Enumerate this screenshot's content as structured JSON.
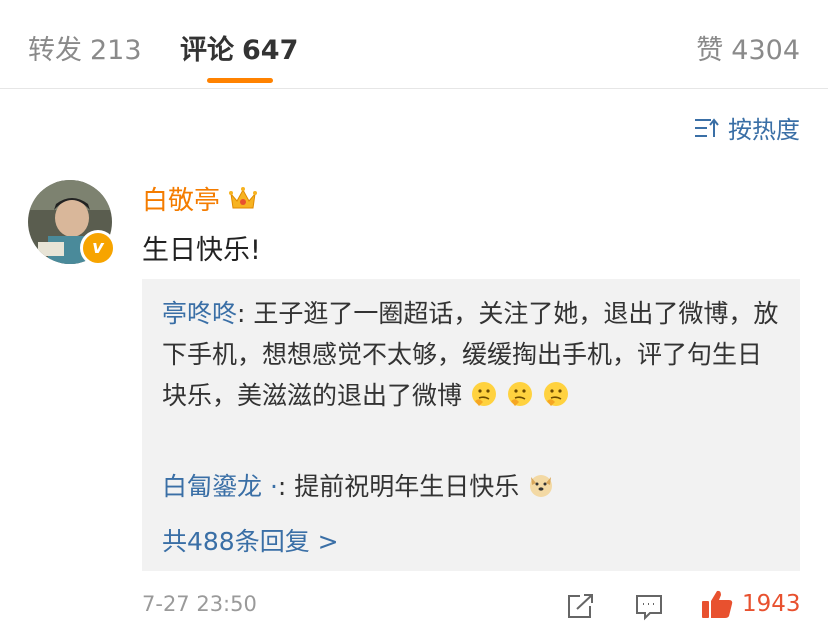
{
  "tabs": {
    "repost": {
      "label": "转发",
      "count": "213"
    },
    "comment": {
      "label": "评论",
      "count": "647"
    },
    "like": {
      "label": "赞",
      "count": "4304"
    }
  },
  "sort": {
    "label": "按热度",
    "icon": "sort-icon"
  },
  "comment": {
    "username": "白敬亭",
    "text": "生日快乐!",
    "time": "7-27 23:50",
    "likes": "1943",
    "badge_text": "v"
  },
  "replies": [
    {
      "name": "亭咚咚",
      "separator": ": ",
      "text": "王子逛了一圈超话，关注了她，退出了微博，放下手机，想想感觉不太够，缓缓掏出手机，评了句生日块乐，美滋滋的退出了微博"
    },
    {
      "name": "白匐鎏龙 ·",
      "separator": ": ",
      "text": "提前祝明年生日快乐"
    }
  ],
  "more_replies": "共488条回复 >",
  "colors": {
    "accent": "#ff8200",
    "link": "#3a6fa6",
    "username": "#f47c00",
    "like": "#e8512f"
  }
}
